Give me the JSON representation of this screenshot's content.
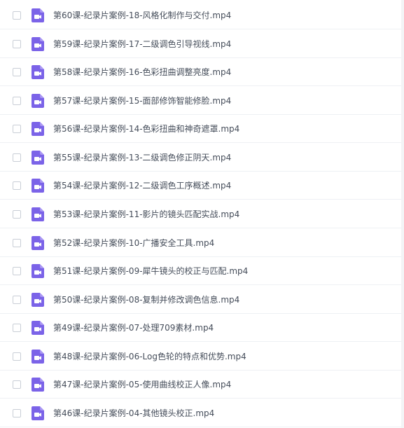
{
  "accent_color": "#7b63e8",
  "file_icon": "video-file-icon",
  "files": [
    {
      "name": "第60课-纪录片案例-18-风格化制作与交付.mp4"
    },
    {
      "name": "第59课-纪录片案例-17-二级调色引导视线.mp4"
    },
    {
      "name": "第58课-纪录片案例-16-色彩扭曲调整亮度.mp4"
    },
    {
      "name": "第57课-纪录片案例-15-面部修饰智能修脸.mp4"
    },
    {
      "name": "第56课-纪录片案例-14-色彩扭曲和神奇遮罩.mp4"
    },
    {
      "name": "第55课-纪录片案例-13-二级调色修正阴天.mp4"
    },
    {
      "name": "第54课-纪录片案例-12-二级调色工序概述.mp4"
    },
    {
      "name": "第53课-纪录片案例-11-影片的镜头匹配实战.mp4"
    },
    {
      "name": "第52课-纪录片案例-10-广播安全工具.mp4"
    },
    {
      "name": "第51课-纪录片案例-09-犀牛镜头的校正与匹配.mp4"
    },
    {
      "name": "第50课-纪录片案例-08-复制并修改调色信息.mp4"
    },
    {
      "name": "第49课-纪录片案例-07-处理709素材.mp4"
    },
    {
      "name": "第48课-纪录片案例-06-Log色轮的特点和优势.mp4"
    },
    {
      "name": "第47课-纪录片案例-05-使用曲线校正人像.mp4"
    },
    {
      "name": "第46课-纪录片案例-04-其他镜头校正.mp4"
    }
  ]
}
